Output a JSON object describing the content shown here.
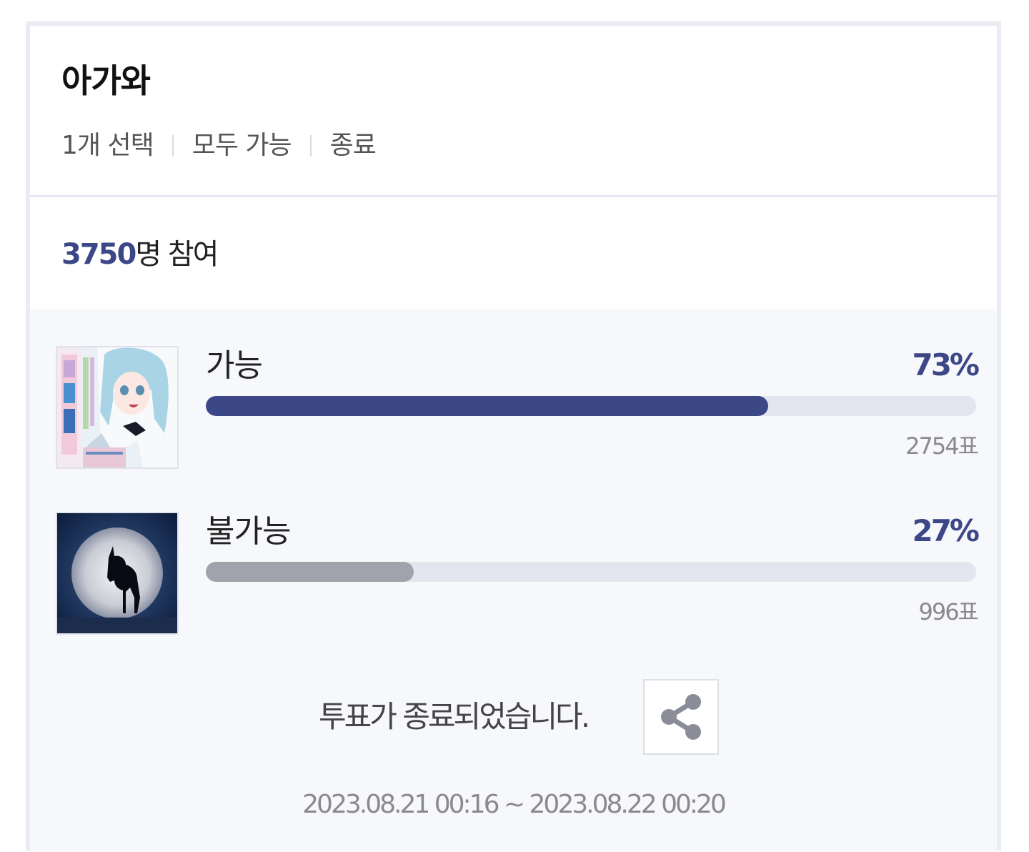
{
  "poll": {
    "title": "아가와",
    "meta": [
      "1개 선택",
      "모두 가능",
      "종료"
    ],
    "participants": {
      "count": "3750",
      "suffix": "명 참여"
    },
    "options": [
      {
        "label": "가능",
        "percent_text": "73%",
        "percent": 73,
        "votes_text": "2754표",
        "bar_color": "#3b4787",
        "thumbnail": "manga-cover-image"
      },
      {
        "label": "불가능",
        "percent_text": "27%",
        "percent": 27,
        "votes_text": "996표",
        "bar_color": "#a0a2ac",
        "thumbnail": "unicorn-moon-image"
      }
    ],
    "ended_text": "투표가 종료되었습니다.",
    "share_icon": "share-icon",
    "period": "2023.08.21 00:16 ~ 2023.08.22 00:20"
  },
  "colors": {
    "accent": "#3b4787",
    "bar_track": "#e3e5ef",
    "secondary_bar": "#a0a2ac",
    "results_bg": "#f7f8fb"
  }
}
